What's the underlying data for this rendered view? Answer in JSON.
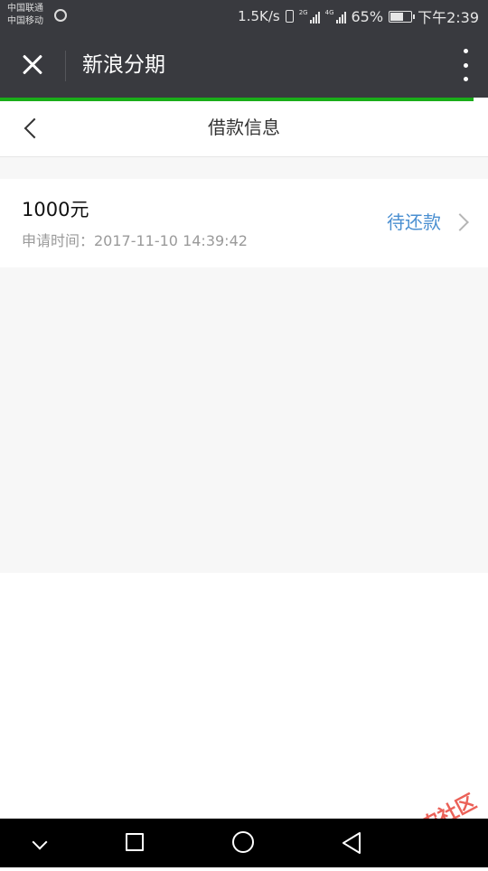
{
  "status_bar": {
    "carrier_1": "中国联通",
    "carrier_2": "中国移动",
    "net_speed": "1.5K/s",
    "signal_1_label": "2G",
    "signal_2_label": "4G",
    "battery": "65%",
    "battery_level": 0.65,
    "time": "下午2:39"
  },
  "app_header": {
    "title": "新浪分期",
    "progress": 0.97,
    "progress_color": "#1aad19"
  },
  "page_header": {
    "title": "借款信息"
  },
  "loans": [
    {
      "amount": "1000元",
      "apply_time": "申请时间：2017-11-10 14:39:42",
      "status": "待还款"
    }
  ],
  "watermark": {
    "text": "卡农社区"
  },
  "icons": {
    "close": "close-icon",
    "more": "more-vertical-icon",
    "back": "chevron-left-icon",
    "row_arrow": "chevron-right-icon",
    "nav": [
      "chevron-down-icon",
      "square-icon",
      "circle-icon",
      "triangle-back-icon"
    ]
  }
}
